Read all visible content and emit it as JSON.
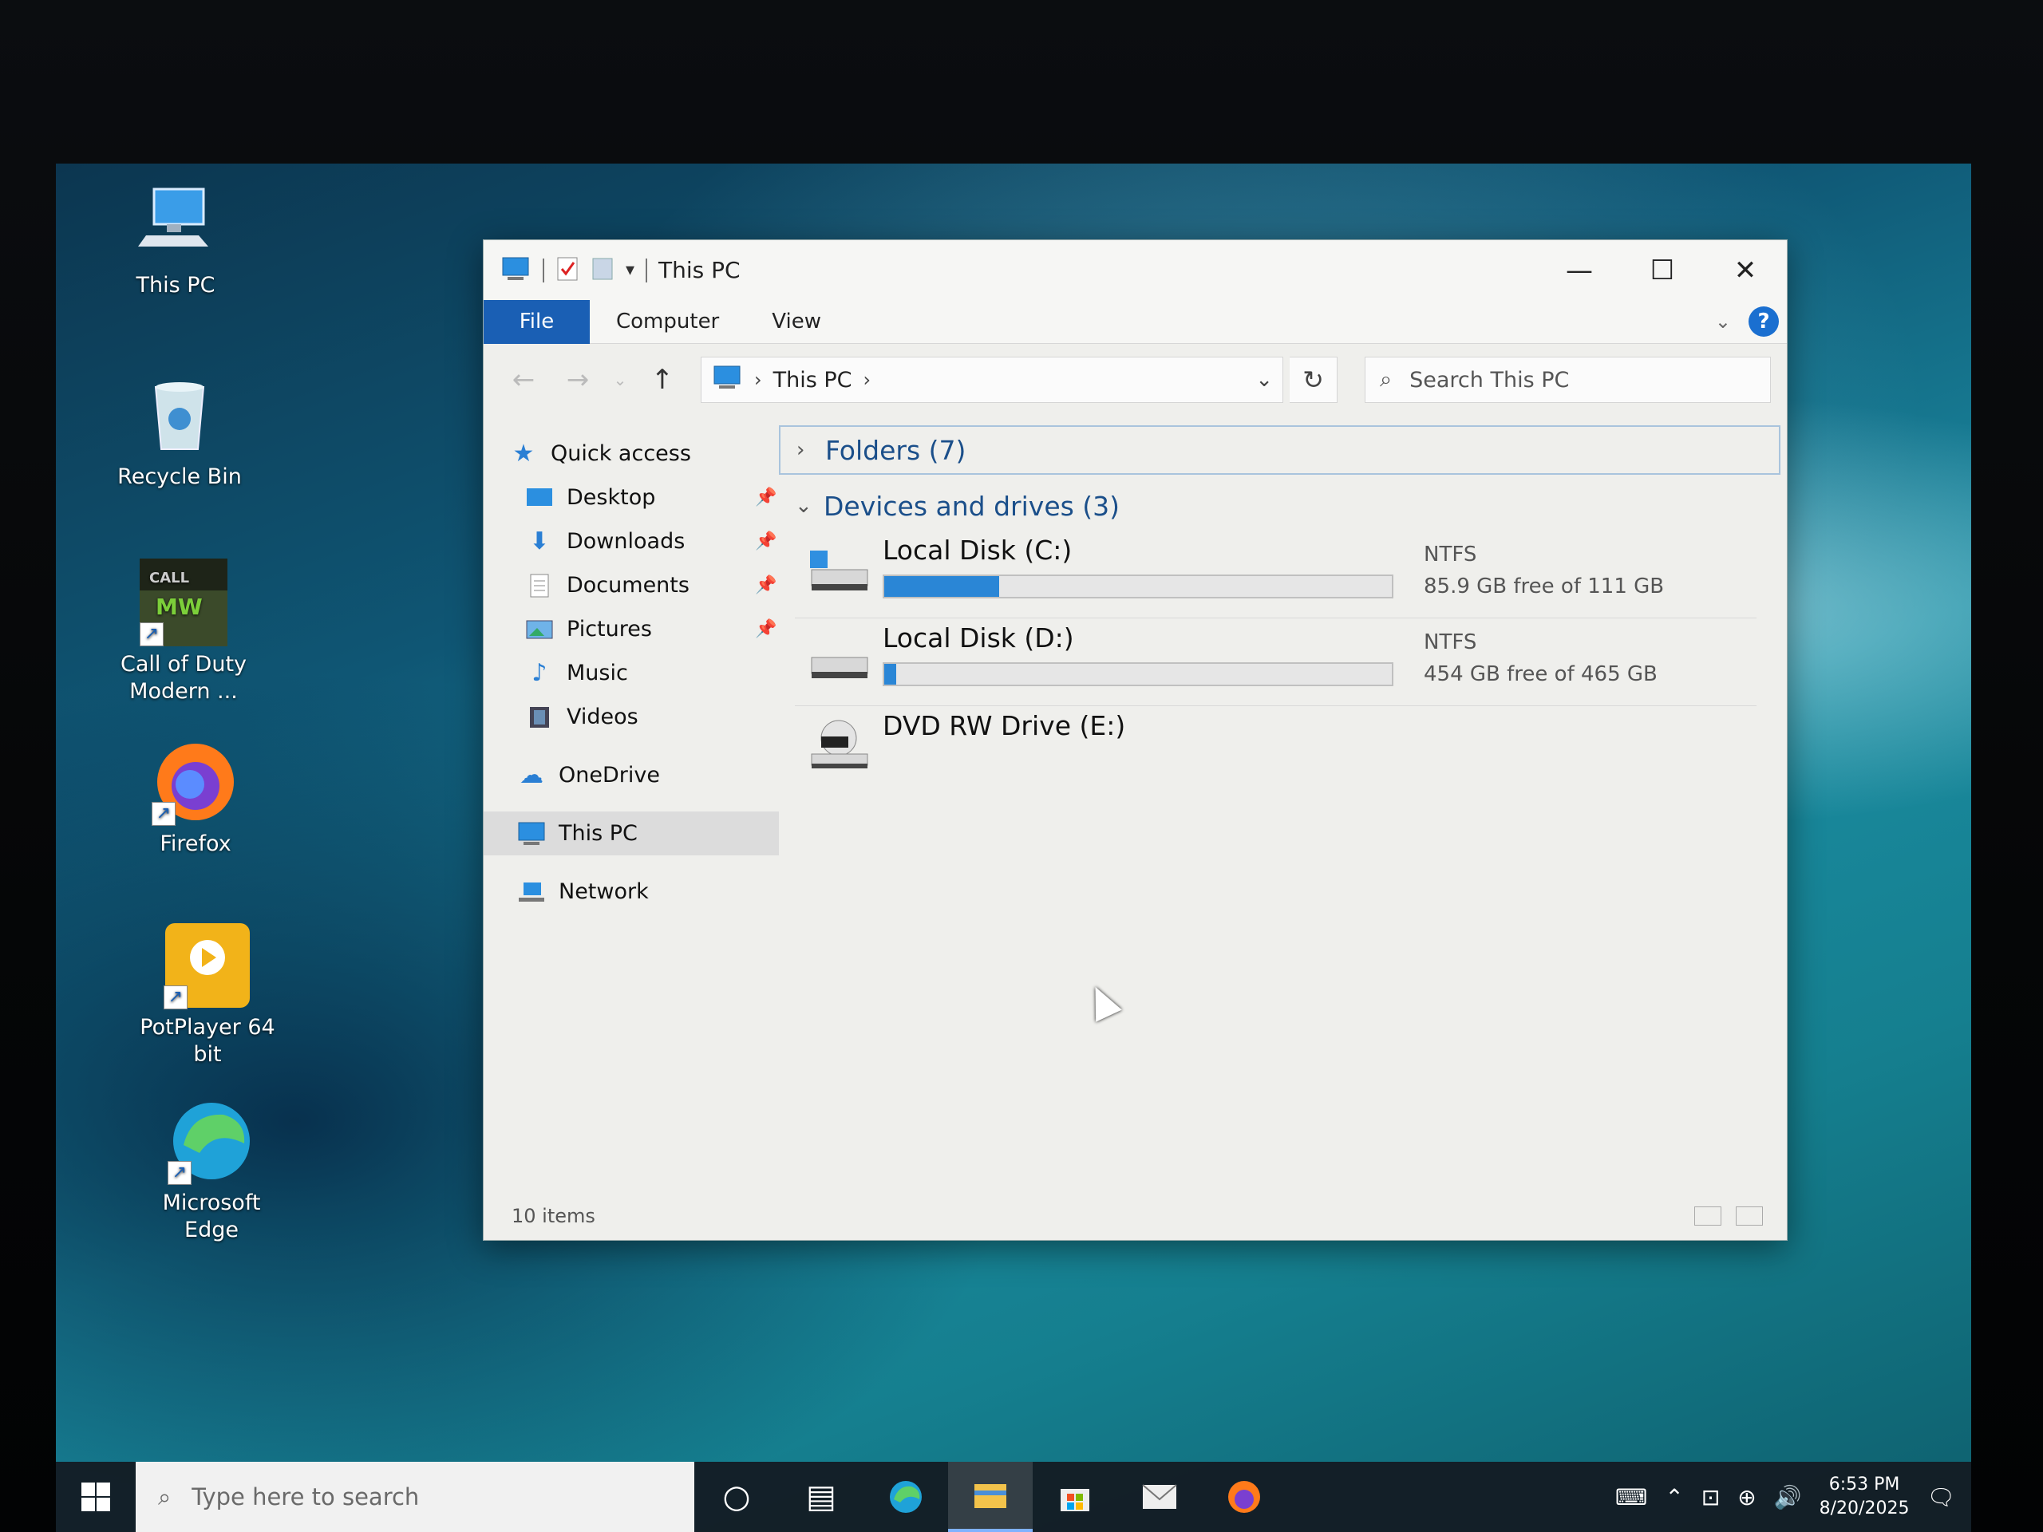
{
  "desktop": {
    "icons": [
      {
        "label": "This PC"
      },
      {
        "label": "Recycle Bin"
      },
      {
        "label": "Call of Duty Modern ..."
      },
      {
        "label": "Firefox"
      },
      {
        "label": "PotPlayer 64 bit"
      },
      {
        "label": "Microsoft Edge"
      }
    ]
  },
  "window": {
    "title": "This PC",
    "buttons": {
      "minimize": "—",
      "maximize": "☐",
      "close": "✕"
    },
    "ribbon": {
      "tabs": [
        "File",
        "Computer",
        "View"
      ]
    },
    "address": {
      "crumb": "This PC"
    },
    "search": {
      "placeholder": "Search This PC"
    },
    "nav": {
      "quick_access": "Quick access",
      "items": [
        "Desktop",
        "Downloads",
        "Documents",
        "Pictures",
        "Music",
        "Videos"
      ],
      "onedrive": "OneDrive",
      "this_pc": "This PC",
      "network": "Network"
    },
    "groups": {
      "folders": "Folders (7)",
      "devices": "Devices and drives (3)"
    },
    "drives": [
      {
        "name": "Local Disk (C:)",
        "fs": "NTFS",
        "free": "85.9 GB free of 111 GB",
        "used_fraction": 0.226
      },
      {
        "name": "Local Disk (D:)",
        "fs": "NTFS",
        "free": "454 GB free of 465 GB",
        "used_fraction": 0.024
      },
      {
        "name": "DVD RW Drive (E:)"
      }
    ],
    "status": "10 items"
  },
  "taskbar": {
    "search_placeholder": "Type here to search",
    "time": "6:53 PM",
    "date": "8/20/2025"
  },
  "colors": {
    "accent": "#1a5fb4",
    "bar_fill": "#2a86d6",
    "group_text": "#1b4f8a"
  }
}
